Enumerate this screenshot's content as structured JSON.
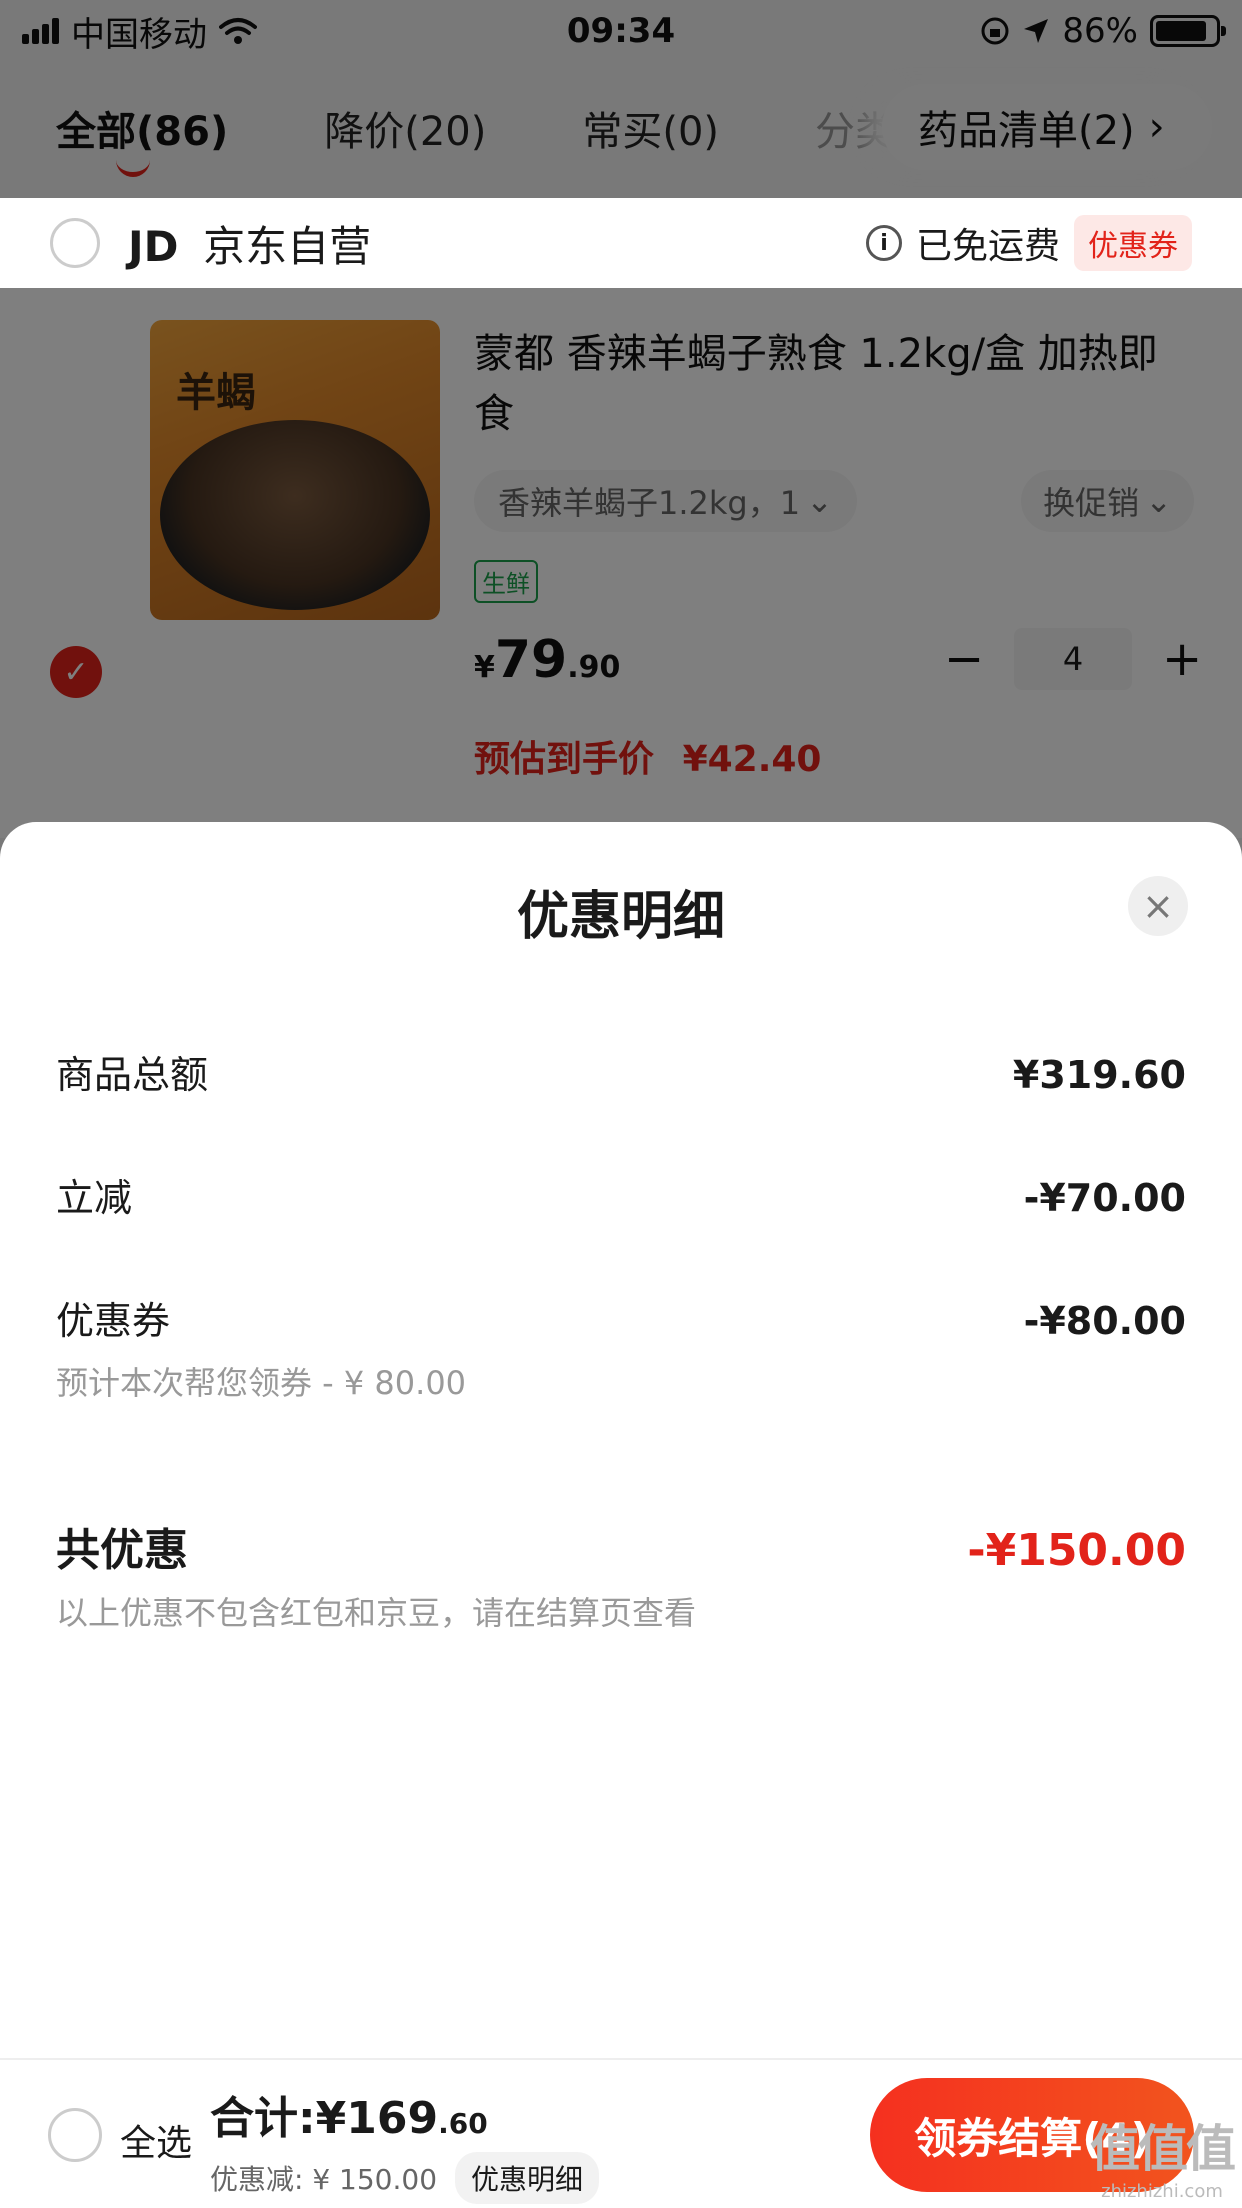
{
  "status_bar": {
    "carrier": "中国移动",
    "time": "09:34",
    "battery": "86%",
    "battery_level": 0.86
  },
  "tabs": [
    {
      "label": "全部(86)"
    },
    {
      "label": "降价(20)"
    },
    {
      "label": "常买(0)"
    },
    {
      "label": "分类"
    }
  ],
  "tab_pill": {
    "label": "药品清单(2)",
    "chevron": "›"
  },
  "store": {
    "logo": "JD",
    "name": "京东自营",
    "shipping": "已免运费",
    "coupon": "优惠券"
  },
  "product": {
    "image_label": "羊蝎",
    "title": "蒙都 香辣羊蝎子熟食 1.2kg/盒 加热即食",
    "spec": "香辣羊蝎子1.2kg，1",
    "promo": "换促销",
    "fresh_tag": "生鲜",
    "price_currency": "¥",
    "price_int": "79",
    "price_dec": ".90",
    "qty_minus": "−",
    "quantity": "4",
    "qty_plus": "+",
    "estimated_label": "预估到手价",
    "estimated_price": "¥42.40"
  },
  "sheet": {
    "title": "优惠明细",
    "close": "×",
    "rows": [
      {
        "label": "商品总额",
        "value": "¥319.60"
      },
      {
        "label": "立减",
        "value": "-¥70.00"
      },
      {
        "label": "优惠券",
        "value": "-¥80.00",
        "note": "预计本次帮您领券 - ¥ 80.00"
      }
    ],
    "total": {
      "label": "共优惠",
      "value": "-¥150.00",
      "note": "以上优惠不包含红包和京豆，请在结算页查看"
    }
  },
  "bottom_bar": {
    "select_all": "全选",
    "sum_label": "合计:",
    "sum_int": "¥169",
    "sum_dec": ".60",
    "discount": "优惠减: ¥ 150.00",
    "detail_button": "优惠明细",
    "checkout": "领券结算(4)"
  },
  "watermark": {
    "logo": "值值值",
    "url": "zhizhizhi.com"
  },
  "colors": {
    "accent": "#e2231a",
    "checkout_start": "#f5301f",
    "checkout_end": "#f2541e",
    "fresh": "#1aa04a"
  },
  "icons": [
    "signal-icon",
    "wifi-icon",
    "lock-rotation-icon",
    "location-arrow-icon",
    "battery-icon",
    "info-icon",
    "check-icon",
    "chevron-down-icon",
    "close-icon"
  ]
}
